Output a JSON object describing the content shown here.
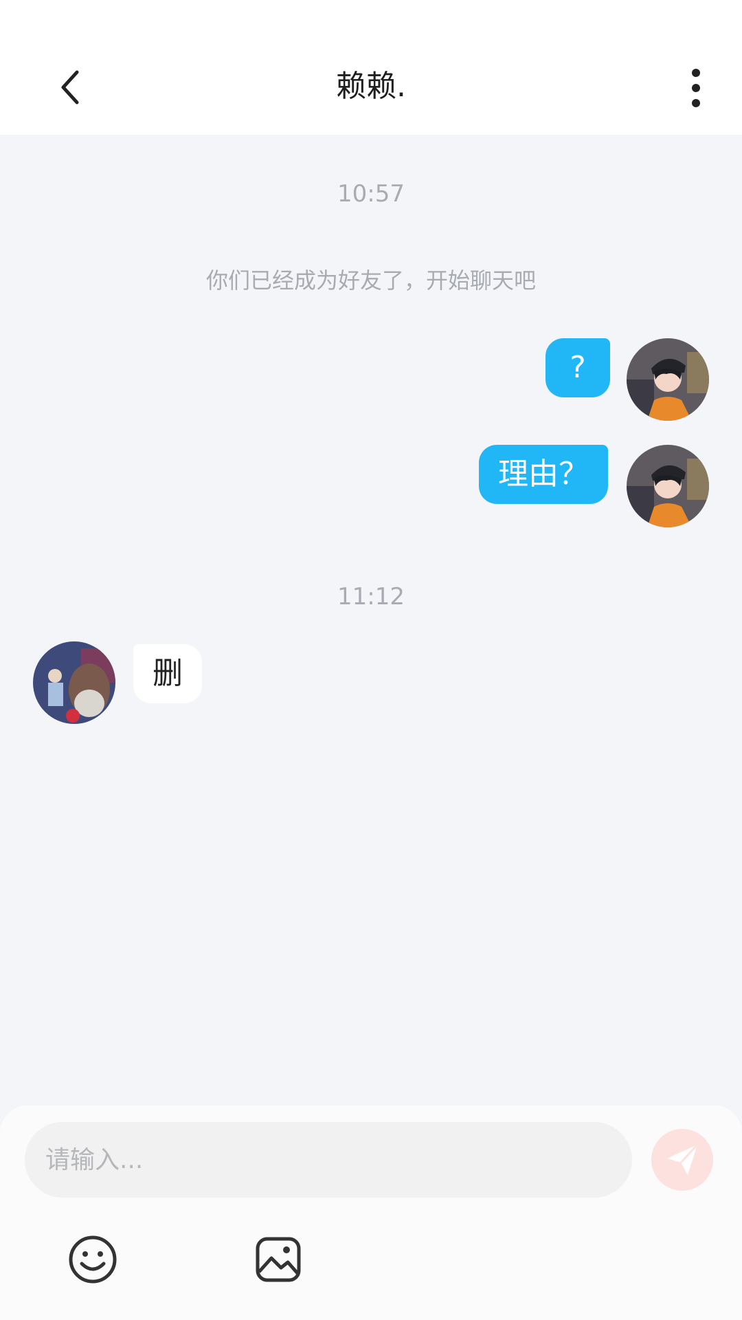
{
  "header": {
    "title": "赖赖."
  },
  "chat": {
    "timestamps": [
      "10:57",
      "11:12"
    ],
    "system_message": "你们已经成为好友了，开始聊天吧",
    "messages": [
      {
        "from": "me",
        "text": "?"
      },
      {
        "from": "me",
        "text": "理由？"
      },
      {
        "from": "other",
        "text": "删"
      }
    ]
  },
  "composer": {
    "placeholder": "请输入..."
  },
  "colors": {
    "my_bubble": "#21b6f6",
    "their_bubble": "#ffffff",
    "background": "#f3f5f8",
    "send_button": "#fde1de"
  },
  "icons": [
    "chevron-left-icon",
    "more-vertical-icon",
    "send-icon",
    "emoji-icon",
    "image-icon"
  ]
}
